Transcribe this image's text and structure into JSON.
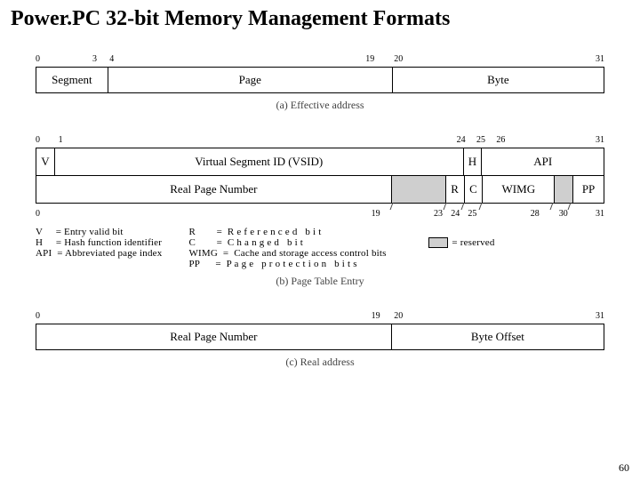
{
  "title": "Power.PC 32-bit Memory Management Formats",
  "page_number": "60",
  "captions": {
    "a": "(a) Effective address",
    "b": "(b) Page Table Entry",
    "c": "(c) Real address"
  },
  "figA": {
    "bits": {
      "b0": "0",
      "b3": "3",
      "b4": "4",
      "b19": "19",
      "b20": "20",
      "b31": "31"
    },
    "fields": {
      "segment": "Segment",
      "page": "Page",
      "byte": "Byte"
    }
  },
  "figB": {
    "w1_bits": {
      "b0": "0",
      "b1": "1",
      "b24": "24",
      "b25": "25",
      "b26": "26",
      "b31": "31"
    },
    "w1_fields": {
      "v": "V",
      "vsid": "Virtual Segment ID (VSID)",
      "h": "H",
      "api": "API"
    },
    "w2_bits": {
      "b0": "0",
      "b19": "19",
      "b23": "23",
      "b24": "24",
      "b25": "25",
      "b28": "28",
      "b30": "30",
      "b31": "31"
    },
    "w2_fields": {
      "rpn": "Real Page Number",
      "r": "R",
      "c": "C",
      "wimg": "WIMG",
      "pp": "PP"
    }
  },
  "figC": {
    "bits": {
      "b0": "0",
      "b19": "19",
      "b20": "20",
      "b31": "31"
    },
    "fields": {
      "rpn": "Real Page Number",
      "byte": "Byte Offset"
    }
  },
  "legend": {
    "col1": "V     = Entry valid bit\nH     = Hash function identifier\nAPI  = Abbreviated page index",
    "col2": "R        =  R e f e r e n c e d   b i t\nC        =  C h a n g e d   b i t\nWIMG  =  Cache and storage access control bits\nPP      =  P a g e   p r o t e c t i o n   b i t s",
    "reserved": "= reserved"
  }
}
